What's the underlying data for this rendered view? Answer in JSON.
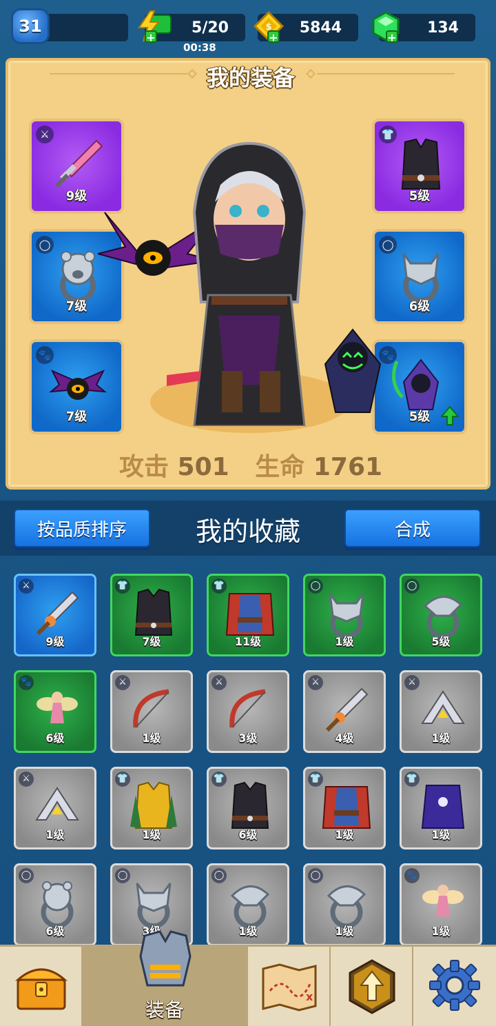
{
  "topbar": {
    "level": "31",
    "energy": "5/20",
    "energy_timer": "00:38",
    "gold": "5844",
    "gems": "134",
    "icons": {
      "energy": "lightning-icon",
      "gold": "gold-coin-icon",
      "gems": "green-gem-icon"
    }
  },
  "equipment": {
    "title": "我的装备",
    "slots_left": [
      {
        "name": "weapon",
        "type_icon": "weapon-slot-icon",
        "item": "pink-sword",
        "level": "9级",
        "rarity": "purple"
      },
      {
        "name": "ring",
        "type_icon": "ring-slot-icon",
        "item": "bear-ring",
        "level": "7级",
        "rarity": "blue"
      },
      {
        "name": "pet",
        "type_icon": "pet-slot-icon",
        "item": "bat-eye-pet",
        "level": "7级",
        "rarity": "blue"
      }
    ],
    "slots_right": [
      {
        "name": "armor",
        "type_icon": "armor-slot-icon",
        "item": "dark-vest",
        "level": "5级",
        "rarity": "purple"
      },
      {
        "name": "ring",
        "type_icon": "ring-slot-icon",
        "item": "wolf-ring",
        "level": "6级",
        "rarity": "blue"
      },
      {
        "name": "pet",
        "type_icon": "pet-slot-icon",
        "item": "reaper-pet",
        "level": "5级",
        "rarity": "blue",
        "upgrade": true
      }
    ],
    "stats": {
      "attack_label": "攻击",
      "attack_value": "501",
      "hp_label": "生命",
      "hp_value": "1761"
    }
  },
  "collection": {
    "sort_button": "按品质排序",
    "title": "我的收藏",
    "merge_button": "合成",
    "items": [
      {
        "item": "serrated-sword",
        "type": "weapon",
        "level": "9级",
        "rarity": "blue"
      },
      {
        "item": "dark-vest",
        "type": "armor",
        "level": "7级",
        "rarity": "green"
      },
      {
        "item": "red-cape-vest",
        "type": "armor",
        "level": "11级",
        "rarity": "green"
      },
      {
        "item": "wolf-ring",
        "type": "ring",
        "level": "1级",
        "rarity": "green"
      },
      {
        "item": "eagle-ring",
        "type": "ring",
        "level": "5级",
        "rarity": "green"
      },
      {
        "item": "fairy-pet",
        "type": "pet",
        "level": "6级",
        "rarity": "green"
      },
      {
        "item": "red-bow",
        "type": "weapon",
        "level": "1级",
        "rarity": "gray"
      },
      {
        "item": "red-bow",
        "type": "weapon",
        "level": "3级",
        "rarity": "gray"
      },
      {
        "item": "serrated-sword",
        "type": "weapon",
        "level": "4级",
        "rarity": "gray"
      },
      {
        "item": "boomerang",
        "type": "weapon",
        "level": "1级",
        "rarity": "gray"
      },
      {
        "item": "boomerang",
        "type": "weapon",
        "level": "1级",
        "rarity": "gray"
      },
      {
        "item": "gold-armor",
        "type": "armor",
        "level": "1级",
        "rarity": "gray"
      },
      {
        "item": "dark-vest",
        "type": "armor",
        "level": "6级",
        "rarity": "gray"
      },
      {
        "item": "red-cape-vest",
        "type": "armor",
        "level": "1级",
        "rarity": "gray"
      },
      {
        "item": "purple-robe",
        "type": "armor",
        "level": "1级",
        "rarity": "gray"
      },
      {
        "item": "bear-ring",
        "type": "ring",
        "level": "6级",
        "rarity": "gray"
      },
      {
        "item": "wolf-ring",
        "type": "ring",
        "level": "3级",
        "rarity": "gray"
      },
      {
        "item": "eagle-ring",
        "type": "ring",
        "level": "1级",
        "rarity": "gray"
      },
      {
        "item": "eagle-ring",
        "type": "ring",
        "level": "1级",
        "rarity": "gray"
      },
      {
        "item": "fairy-pet",
        "type": "pet",
        "level": "1级",
        "rarity": "gray"
      }
    ]
  },
  "bottom_nav": {
    "items": [
      {
        "name": "shop",
        "icon": "treasure-chest-icon",
        "label": ""
      },
      {
        "name": "equipment",
        "icon": "armor-icon",
        "label": "装备",
        "active": true
      },
      {
        "name": "map",
        "icon": "treasure-map-icon",
        "label": ""
      },
      {
        "name": "upgrade",
        "icon": "upgrade-arrow-icon",
        "label": ""
      },
      {
        "name": "settings",
        "icon": "gear-icon",
        "label": ""
      }
    ]
  }
}
